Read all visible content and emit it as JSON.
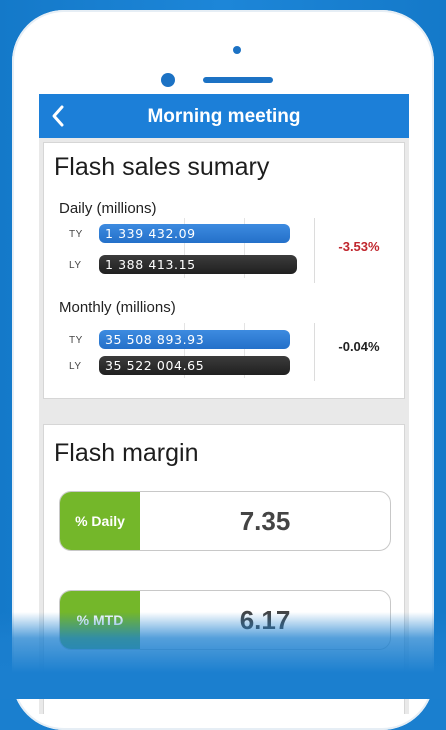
{
  "header": {
    "title": "Morning meeting",
    "back_icon": "chevron-left-icon"
  },
  "sales_card": {
    "title": "Flash sales sumary",
    "daily": {
      "label": "Daily (millions)",
      "ty_tag": "TY",
      "ty_value": "1 339 432.09",
      "ly_tag": "LY",
      "ly_value": "1 388 413.15",
      "change": "-3.53%"
    },
    "monthly": {
      "label": "Monthly (millions)",
      "ty_tag": "TY",
      "ty_value": "35 508 893.93",
      "ly_tag": "LY",
      "ly_value": "35 522 004.65",
      "change": "-0.04%"
    }
  },
  "margin_card": {
    "title": "Flash margin",
    "daily": {
      "label": "% Daily",
      "value": "7.35"
    },
    "mtd": {
      "label": "% MTD",
      "value": "6.17"
    }
  },
  "colors": {
    "header": "#1c7fd8",
    "ty_bar": "#2f7ed8",
    "ly_bar": "#2a2a2a",
    "negative": "#c0262d",
    "neutral": "#222222",
    "margin_tag": "#74b72a",
    "background": "#1b7fcf"
  }
}
